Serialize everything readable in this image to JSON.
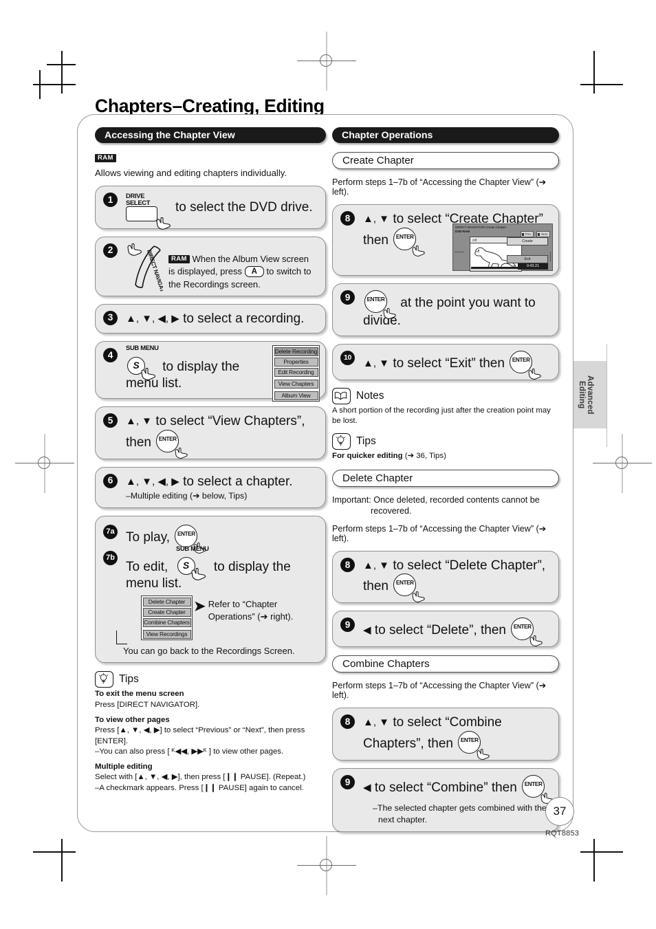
{
  "page": {
    "title": "Chapters–Creating, Editing",
    "number": "37",
    "doc_code": "RQT8853",
    "side_tab": "Advanced Editing"
  },
  "left": {
    "section_title": "Accessing the Chapter View",
    "disc_badge": "RAM",
    "intro": "Allows viewing and editing chapters individually.",
    "steps": {
      "s1": {
        "num": "1",
        "key_caption": "DRIVE\nSELECT",
        "key_caption_line1": "DRIVE",
        "key_caption_line2": "SELECT",
        "text": "to select the DVD drive."
      },
      "s2": {
        "num": "2",
        "key_label": "DIRECT NAVIGATOR",
        "badge": "RAM",
        "text_a": "When the Album View screen",
        "text_b": "is displayed, press",
        "button": "A",
        "text_c": "to switch to",
        "text_d": "the Recordings screen."
      },
      "s3": {
        "num": "3",
        "arrows": "▲, ▼, ◀, ▶",
        "text": "to select a recording."
      },
      "s4": {
        "num": "4",
        "key_caption": "SUB MENU",
        "key_label": "S",
        "text": "to display the menu list.",
        "menu": [
          "Delete Recording",
          "Properties",
          "Edit Recording",
          "View Chapters",
          "Album View"
        ]
      },
      "s5": {
        "num": "5",
        "arrows": "▲, ▼",
        "text": "to select “View Chapters”,",
        "text2": "then",
        "enter": "ENTER"
      },
      "s6": {
        "num": "6",
        "arrows": "▲, ▼, ◀, ▶",
        "text": "to select a chapter.",
        "sub": "–Multiple editing (➔ below, Tips)"
      },
      "s7": {
        "num_a": "7a",
        "num_b": "7b",
        "text_a": "To play,",
        "enter": "ENTER",
        "key_caption": "SUB MENU",
        "key_label": "S",
        "text_b": "To edit,",
        "text_b2": "to display the",
        "text_b3": "menu list.",
        "menu": [
          "Delete Chapter",
          "Create Chapter",
          "Combine Chapters",
          "View Recordings"
        ],
        "refer_a": "Refer to “Chapter",
        "refer_b": "Operations” (➔ right).",
        "footer": "You can go back to the Recordings Screen."
      }
    },
    "tips": {
      "title": "Tips",
      "blocks": [
        {
          "head": "To exit the menu screen",
          "lines": [
            "Press [DIRECT NAVIGATOR]."
          ]
        },
        {
          "head": "To view other pages",
          "lines": [
            "Press [▲, ▼, ◀, ▶] to select “Previous” or “Next”, then press",
            "[ENTER].",
            "–You can also press [ ᴷ◀◀, ▶▶ᴷ ] to view other pages."
          ]
        },
        {
          "head": "Multiple editing",
          "lines": [
            "Select with [▲, ▼, ◀, ▶], then press [❙❙ PAUSE]. (Repeat.)",
            "–A checkmark appears. Press [❙❙ PAUSE] again to cancel."
          ]
        }
      ]
    }
  },
  "right": {
    "section_title": "Chapter Operations",
    "create": {
      "heading": "Create Chapter",
      "perform": "Perform steps 1–7b of “Accessing the Chapter View” (➔ left).",
      "s8": {
        "num": "8",
        "arrows": "▲, ▼",
        "text": "to select “Create Chapter”",
        "text2": "then",
        "enter": "ENTER"
      },
      "screen": {
        "title": "DIRECT NAVIGATOR  Create Chapter",
        "disc": "DVD-RAM",
        "tag_prev": "Prev",
        "tag_next": "Next",
        "thumb_left": "Off",
        "thumb_right": "Play",
        "btn_create": "Create",
        "btn_exit": "Exit",
        "time": "0:43.21"
      },
      "s9": {
        "num": "9",
        "enter": "ENTER",
        "text": "at the point you want to divide."
      },
      "s10": {
        "num": "10",
        "arrows": "▲, ▼",
        "text": "to select “Exit” then",
        "enter": "ENTER"
      },
      "notes": {
        "title": "Notes",
        "body": "A short portion of the recording just after the creation point may be lost."
      },
      "tips": {
        "title": "Tips",
        "body_bold": "For quicker editing",
        "body_rest": " (➔ 36, Tips)"
      }
    },
    "delete": {
      "heading": "Delete Chapter",
      "important_a": "Important: Once deleted, recorded contents cannot be",
      "important_b": "recovered.",
      "perform": "Perform steps 1–7b of “Accessing the Chapter View” (➔ left).",
      "s8": {
        "num": "8",
        "arrows": "▲, ▼",
        "text": "to select “Delete Chapter”,",
        "text2": "then",
        "enter": "ENTER"
      },
      "s9": {
        "num": "9",
        "arrows": "◀",
        "text": "to select “Delete”, then",
        "enter": "ENTER"
      }
    },
    "combine": {
      "heading": "Combine Chapters",
      "perform": "Perform steps 1–7b of “Accessing the Chapter View” (➔ left).",
      "s8": {
        "num": "8",
        "arrows": "▲, ▼",
        "text": "to select “Combine",
        "text2": "Chapters”, then",
        "enter": "ENTER"
      },
      "s9": {
        "num": "9",
        "arrows": "◀",
        "text": "to select “Combine” then",
        "enter": "ENTER",
        "sub_a": "–The selected chapter gets combined with the",
        "sub_b": "next chapter."
      }
    }
  }
}
